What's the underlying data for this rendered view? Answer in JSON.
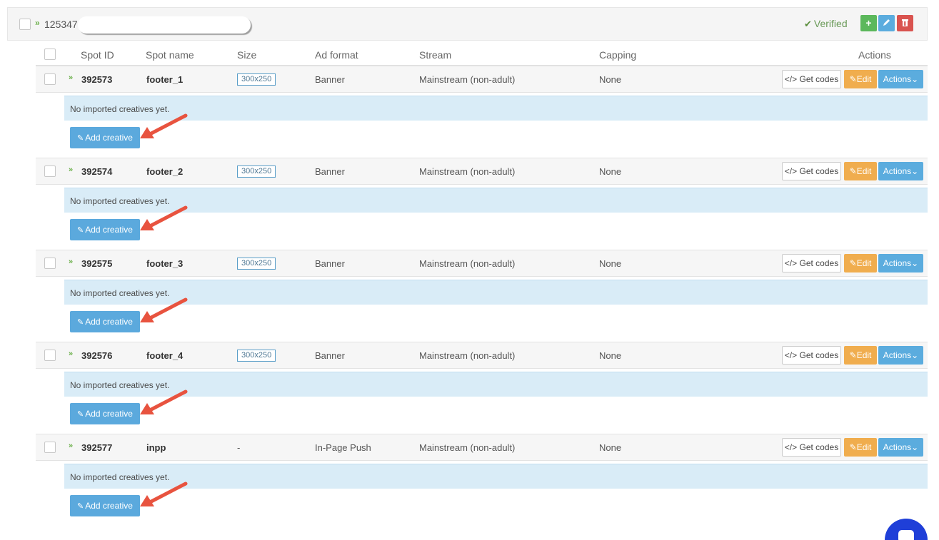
{
  "site": {
    "id": "125347.",
    "status": "Verified"
  },
  "table": {
    "headers": {
      "spot_id": "Spot ID",
      "spot_name": "Spot name",
      "size": "Size",
      "ad_format": "Ad format",
      "stream": "Stream",
      "capping": "Capping",
      "actions": "Actions"
    }
  },
  "spots": [
    {
      "id": "392573",
      "name": "footer_1",
      "size": "300x250",
      "format": "Banner",
      "stream": "Mainstream (non-adult)",
      "capping": "None",
      "note": "No imported creatives yet.",
      "add_label": "Add creative",
      "get_codes": "Get codes",
      "edit": "Edit",
      "actions": "Actions"
    },
    {
      "id": "392574",
      "name": "footer_2",
      "size": "300x250",
      "format": "Banner",
      "stream": "Mainstream (non-adult)",
      "capping": "None",
      "note": "No imported creatives yet.",
      "add_label": "Add creative",
      "get_codes": "Get codes",
      "edit": "Edit",
      "actions": "Actions"
    },
    {
      "id": "392575",
      "name": "footer_3",
      "size": "300x250",
      "format": "Banner",
      "stream": "Mainstream (non-adult)",
      "capping": "None",
      "note": "No imported creatives yet.",
      "add_label": "Add creative",
      "get_codes": "Get codes",
      "edit": "Edit",
      "actions": "Actions"
    },
    {
      "id": "392576",
      "name": "footer_4",
      "size": "300x250",
      "format": "Banner",
      "stream": "Mainstream (non-adult)",
      "capping": "None",
      "note": "No imported creatives yet.",
      "add_label": "Add creative",
      "get_codes": "Get codes",
      "edit": "Edit",
      "actions": "Actions"
    },
    {
      "id": "392577",
      "name": "inpp",
      "size": "-",
      "format": "In-Page Push",
      "stream": "Mainstream (non-adult)",
      "capping": "None",
      "note": "No imported creatives yet.",
      "add_label": "Add creative",
      "get_codes": "Get codes",
      "edit": "Edit",
      "actions": "Actions"
    }
  ],
  "colors": {
    "accent_blue": "#5bacde",
    "edit_orange": "#f0ad4e",
    "add_green": "#5cb85c",
    "delete_red": "#d9534f",
    "arrow_red": "#e8533f"
  }
}
